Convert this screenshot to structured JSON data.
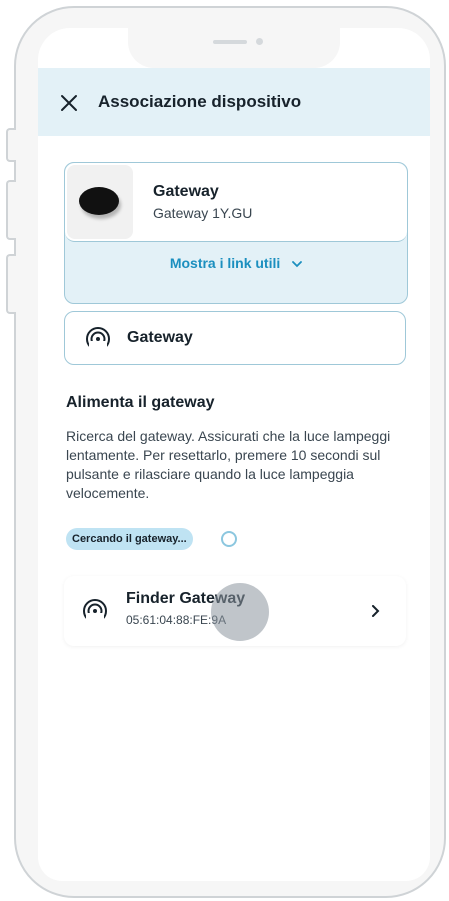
{
  "header": {
    "title": "Associazione dispositivo",
    "close_icon": "close-icon"
  },
  "device": {
    "name": "Gateway",
    "model": "Gateway 1Y.GU",
    "links_label": "Mostra i link utili",
    "links_icon": "chevron-down-icon"
  },
  "gateway_chip": {
    "label": "Gateway",
    "icon": "signal-icon"
  },
  "section": {
    "title": "Alimenta il gateway",
    "text": "Ricerca del gateway. Assicurati che la luce lampeggi lentamente. Per resettarlo, premere 10 secondi sul pulsante e rilasciare quando la luce lampeggia velocemente."
  },
  "search": {
    "badge": "Cercando il gateway...",
    "spinner_icon": "spinner-icon"
  },
  "found_device": {
    "name": "Finder Gateway",
    "mac": "05:61:04:88:FE:9A",
    "icon": "signal-icon",
    "chevron_icon": "chevron-right-icon"
  },
  "colors": {
    "accent": "#1b8fbf",
    "header_bg": "#e3f1f7",
    "card_border": "#9fc8d8",
    "badge_bg": "#bfe3f3"
  }
}
